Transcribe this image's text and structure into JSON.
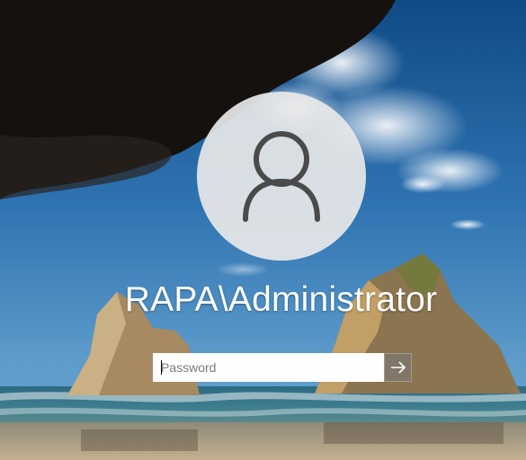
{
  "user": {
    "display_name": "RAPA\\Administrator",
    "avatar_icon": "user-silhouette-icon"
  },
  "login": {
    "password_placeholder": "Password",
    "password_value": "",
    "submit_icon": "arrow-right-icon"
  },
  "colors": {
    "sky_top": "#1e5f9c",
    "sky_mid": "#3c7fb8",
    "sea": "#2f6f80",
    "sand": "#b9a68a",
    "avatar_bg": "#e8e8e8",
    "avatar_icon": "#4a4a4a"
  }
}
